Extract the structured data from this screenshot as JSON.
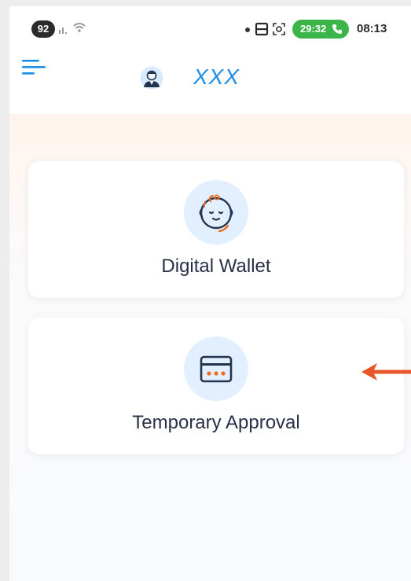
{
  "status_bar": {
    "battery": "92",
    "call_timer": "29:32",
    "clock": "08:13"
  },
  "header": {
    "user_name": "XXX"
  },
  "menu": [
    {
      "label": "Digital Wallet",
      "icon": "baby-face-icon"
    },
    {
      "label": "Temporary Approval",
      "icon": "card-icon"
    }
  ],
  "colors": {
    "accent": "#1e8ee8",
    "icon_circle": "#e2efff",
    "icon_orange": "#f26a1b",
    "call_green": "#3bb54a",
    "arrow": "#e8572a"
  }
}
